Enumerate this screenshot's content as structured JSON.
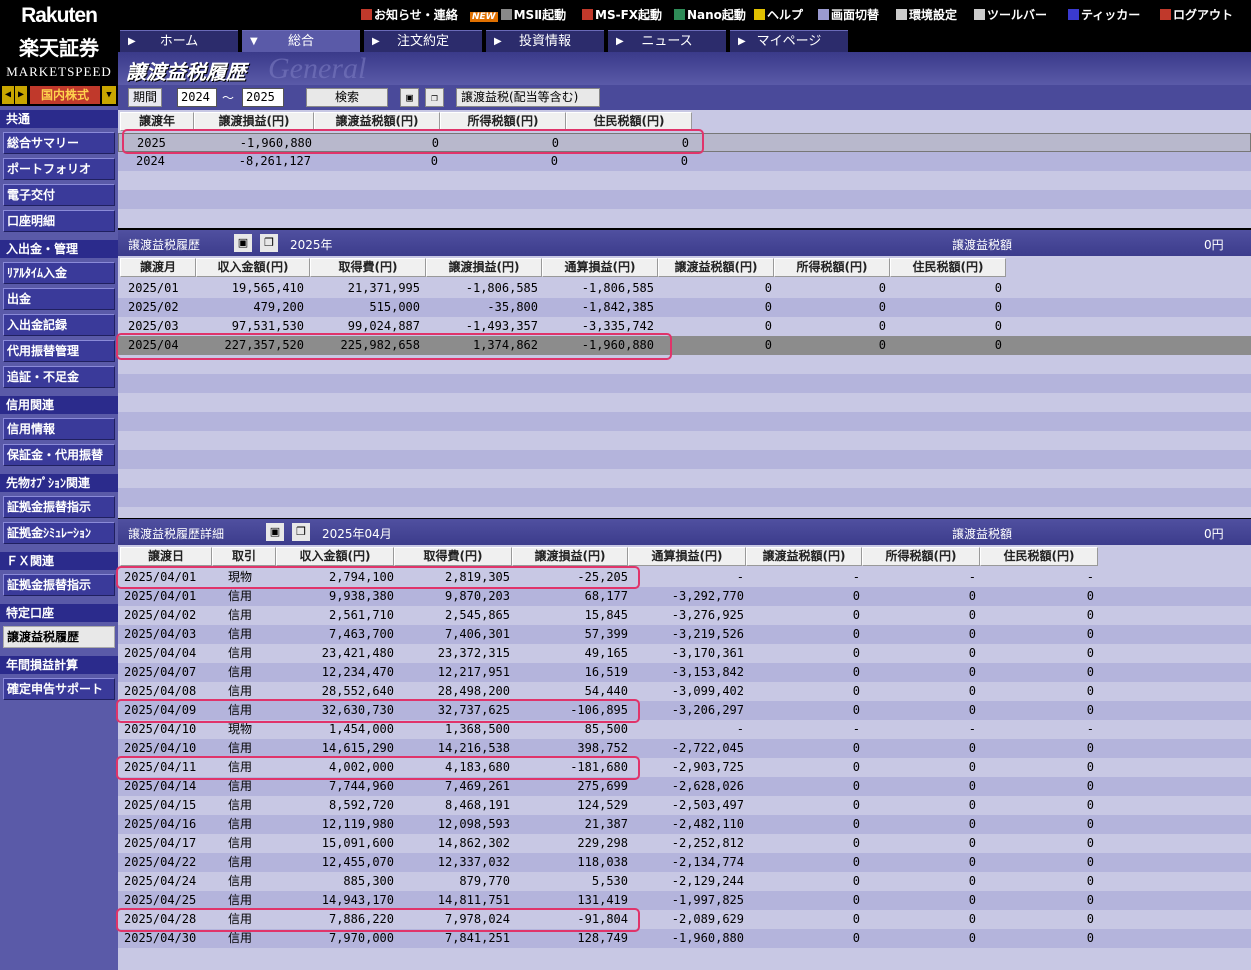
{
  "brand": {
    "name_en": "Rakuten",
    "name_jp": "楽天証券",
    "product": "MARKETSPEED"
  },
  "market_selector": {
    "value": "国内株式"
  },
  "top_menu": [
    {
      "label": "お知らせ・連絡",
      "icon": "notice-icon"
    },
    {
      "label": "MSⅡ起動",
      "icon": "launch-icon",
      "badge": "NEW"
    },
    {
      "label": "MS-FX起動",
      "icon": "fx-icon"
    },
    {
      "label": "Nano起動",
      "icon": "nano-icon"
    },
    {
      "label": "ヘルプ",
      "icon": "help-icon"
    },
    {
      "label": "画面切替",
      "icon": "switch-icon"
    },
    {
      "label": "環境設定",
      "icon": "settings-icon"
    },
    {
      "label": "ツールバー",
      "icon": "toolbar-icon"
    },
    {
      "label": "ティッカー",
      "icon": "ticker-icon"
    },
    {
      "label": "ログアウト",
      "icon": "logout-icon"
    }
  ],
  "tabs": [
    "ホーム",
    "総合",
    "注文約定",
    "投資情報",
    "ニュース",
    "マイページ"
  ],
  "active_tab": "総合",
  "sidebar": {
    "sections": [
      {
        "title": "共通",
        "items": [
          "総合サマリー",
          "ポートフォリオ",
          "電子交付",
          "口座明細"
        ]
      },
      {
        "title": "入出金・管理",
        "items": [
          "ﾘｱﾙﾀｲﾑ入金",
          "出金",
          "入出金記録",
          "代用振替管理",
          "追証・不足金"
        ]
      },
      {
        "title": "信用関連",
        "items": [
          "信用情報",
          "保証金・代用振替"
        ]
      },
      {
        "title": "先物ｵﾌﾟｼｮﾝ関連",
        "items": [
          "証拠金振替指示",
          "証拠金ｼﾐｭﾚｰｼｮﾝ"
        ]
      },
      {
        "title": "ＦＸ関連",
        "items": [
          "証拠金振替指示"
        ]
      },
      {
        "title": "特定口座",
        "items": [
          "譲渡益税履歴"
        ]
      },
      {
        "title": "年間損益計算",
        "items": [
          "確定申告サポート"
        ]
      }
    ],
    "active_item": "譲渡益税履歴"
  },
  "page_title": "譲渡益税履歴",
  "page_title_watermark": "General",
  "toolbar": {
    "period_label": "期間",
    "from": "2024",
    "sep": "〜",
    "to": "2025",
    "search_label": "検索",
    "type_label": "譲渡益税(配当等含む)"
  },
  "yearly": {
    "headers": [
      "譲渡年",
      "譲渡損益(円)",
      "譲渡益税額(円)",
      "所得税額(円)",
      "住民税額(円)"
    ],
    "rows": [
      [
        "2025",
        "-1,960,880",
        "0",
        "0",
        "0"
      ],
      [
        "2024",
        "-8,261,127",
        "0",
        "0",
        "0"
      ]
    ]
  },
  "monthly": {
    "title": "譲渡益税履歴",
    "year": "2025年",
    "tax_label": "譲渡益税額",
    "tax_value": "0円",
    "headers": [
      "譲渡月",
      "収入金額(円)",
      "取得費(円)",
      "譲渡損益(円)",
      "通算損益(円)",
      "譲渡益税額(円)",
      "所得税額(円)",
      "住民税額(円)"
    ],
    "rows": [
      [
        "2025/01",
        "19,565,410",
        "21,371,995",
        "-1,806,585",
        "-1,806,585",
        "0",
        "0",
        "0"
      ],
      [
        "2025/02",
        "479,200",
        "515,000",
        "-35,800",
        "-1,842,385",
        "0",
        "0",
        "0"
      ],
      [
        "2025/03",
        "97,531,530",
        "99,024,887",
        "-1,493,357",
        "-3,335,742",
        "0",
        "0",
        "0"
      ],
      [
        "2025/04",
        "227,357,520",
        "225,982,658",
        "1,374,862",
        "-1,960,880",
        "0",
        "0",
        "0"
      ]
    ]
  },
  "detail": {
    "title": "譲渡益税履歴詳細",
    "month": "2025年04月",
    "tax_label": "譲渡益税額",
    "tax_value": "0円",
    "headers": [
      "譲渡日",
      "取引",
      "収入金額(円)",
      "取得費(円)",
      "譲渡損益(円)",
      "通算損益(円)",
      "譲渡益税額(円)",
      "所得税額(円)",
      "住民税額(円)"
    ],
    "rows": [
      [
        "2025/04/01",
        "現物",
        "2,794,100",
        "2,819,305",
        "-25,205",
        "-",
        "-",
        "-",
        "-"
      ],
      [
        "2025/04/01",
        "信用",
        "9,938,380",
        "9,870,203",
        "68,177",
        "-3,292,770",
        "0",
        "0",
        "0"
      ],
      [
        "2025/04/02",
        "信用",
        "2,561,710",
        "2,545,865",
        "15,845",
        "-3,276,925",
        "0",
        "0",
        "0"
      ],
      [
        "2025/04/03",
        "信用",
        "7,463,700",
        "7,406,301",
        "57,399",
        "-3,219,526",
        "0",
        "0",
        "0"
      ],
      [
        "2025/04/04",
        "信用",
        "23,421,480",
        "23,372,315",
        "49,165",
        "-3,170,361",
        "0",
        "0",
        "0"
      ],
      [
        "2025/04/07",
        "信用",
        "12,234,470",
        "12,217,951",
        "16,519",
        "-3,153,842",
        "0",
        "0",
        "0"
      ],
      [
        "2025/04/08",
        "信用",
        "28,552,640",
        "28,498,200",
        "54,440",
        "-3,099,402",
        "0",
        "0",
        "0"
      ],
      [
        "2025/04/09",
        "信用",
        "32,630,730",
        "32,737,625",
        "-106,895",
        "-3,206,297",
        "0",
        "0",
        "0"
      ],
      [
        "2025/04/10",
        "現物",
        "1,454,000",
        "1,368,500",
        "85,500",
        "-",
        "-",
        "-",
        "-"
      ],
      [
        "2025/04/10",
        "信用",
        "14,615,290",
        "14,216,538",
        "398,752",
        "-2,722,045",
        "0",
        "0",
        "0"
      ],
      [
        "2025/04/11",
        "信用",
        "4,002,000",
        "4,183,680",
        "-181,680",
        "-2,903,725",
        "0",
        "0",
        "0"
      ],
      [
        "2025/04/14",
        "信用",
        "7,744,960",
        "7,469,261",
        "275,699",
        "-2,628,026",
        "0",
        "0",
        "0"
      ],
      [
        "2025/04/15",
        "信用",
        "8,592,720",
        "8,468,191",
        "124,529",
        "-2,503,497",
        "0",
        "0",
        "0"
      ],
      [
        "2025/04/16",
        "信用",
        "12,119,980",
        "12,098,593",
        "21,387",
        "-2,482,110",
        "0",
        "0",
        "0"
      ],
      [
        "2025/04/17",
        "信用",
        "15,091,600",
        "14,862,302",
        "229,298",
        "-2,252,812",
        "0",
        "0",
        "0"
      ],
      [
        "2025/04/22",
        "信用",
        "12,455,070",
        "12,337,032",
        "118,038",
        "-2,134,774",
        "0",
        "0",
        "0"
      ],
      [
        "2025/04/24",
        "信用",
        "885,300",
        "879,770",
        "5,530",
        "-2,129,244",
        "0",
        "0",
        "0"
      ],
      [
        "2025/04/25",
        "信用",
        "14,943,170",
        "14,811,751",
        "131,419",
        "-1,997,825",
        "0",
        "0",
        "0"
      ],
      [
        "2025/04/28",
        "信用",
        "7,886,220",
        "7,978,024",
        "-91,804",
        "-2,089,629",
        "0",
        "0",
        "0"
      ],
      [
        "2025/04/30",
        "信用",
        "7,970,000",
        "7,841,251",
        "128,749",
        "-1,960,880",
        "0",
        "0",
        "0"
      ]
    ]
  },
  "colors": {
    "highlight": "#e0346a",
    "panel": "#c8c8e4",
    "stripe": "#b4b4dc",
    "selected_row": "#8c8c8c"
  }
}
